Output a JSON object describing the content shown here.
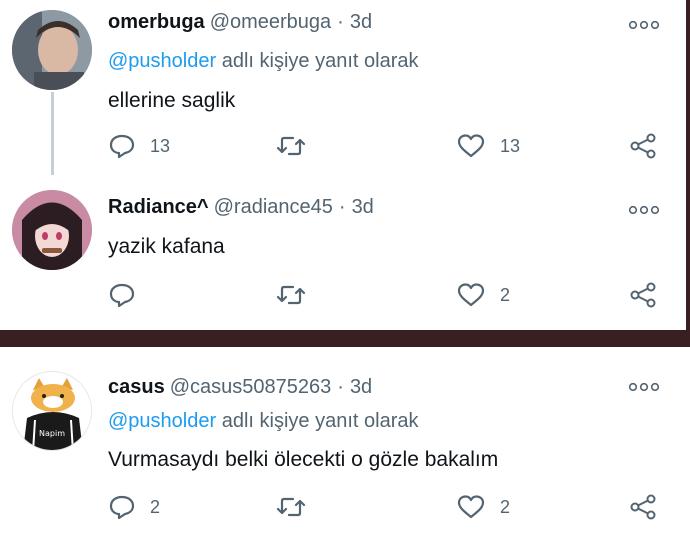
{
  "tweets": [
    {
      "display_name": "omerbuga",
      "handle": "@omeerbuga",
      "time": "3d",
      "reply_to_mention": "@pusholder",
      "reply_to_suffix": "adlı kişiye yanıt olarak",
      "text": "ellerine saglik",
      "replies": "13",
      "retweets": "",
      "likes": "13"
    },
    {
      "display_name": "Radiance^",
      "handle": "@radiance45",
      "time": "3d",
      "text": "yazik kafana",
      "replies": "",
      "retweets": "",
      "likes": "2"
    },
    {
      "display_name": "casus",
      "handle": "@casus50875263",
      "time": "3d",
      "reply_to_mention": "@pusholder",
      "reply_to_suffix": "adlı kişiye yanıt olarak",
      "text": "Vurmasaydı belki ölecekti o gözle bakalım",
      "replies": "2",
      "retweets": "",
      "likes": "2",
      "avatar_badge": "Napim"
    }
  ],
  "separator": "·",
  "icons": {
    "reply": "speech-bubble-icon",
    "retweet": "retweet-icon",
    "like": "heart-icon",
    "share": "share-icon",
    "more": "more-dots-icon"
  },
  "colors": {
    "mention": "#1d9bf0",
    "secondary_text": "#536471",
    "primary_text": "#0f1419",
    "thread_line": "#c4cfd6",
    "background_dark": "#3a1f22"
  }
}
